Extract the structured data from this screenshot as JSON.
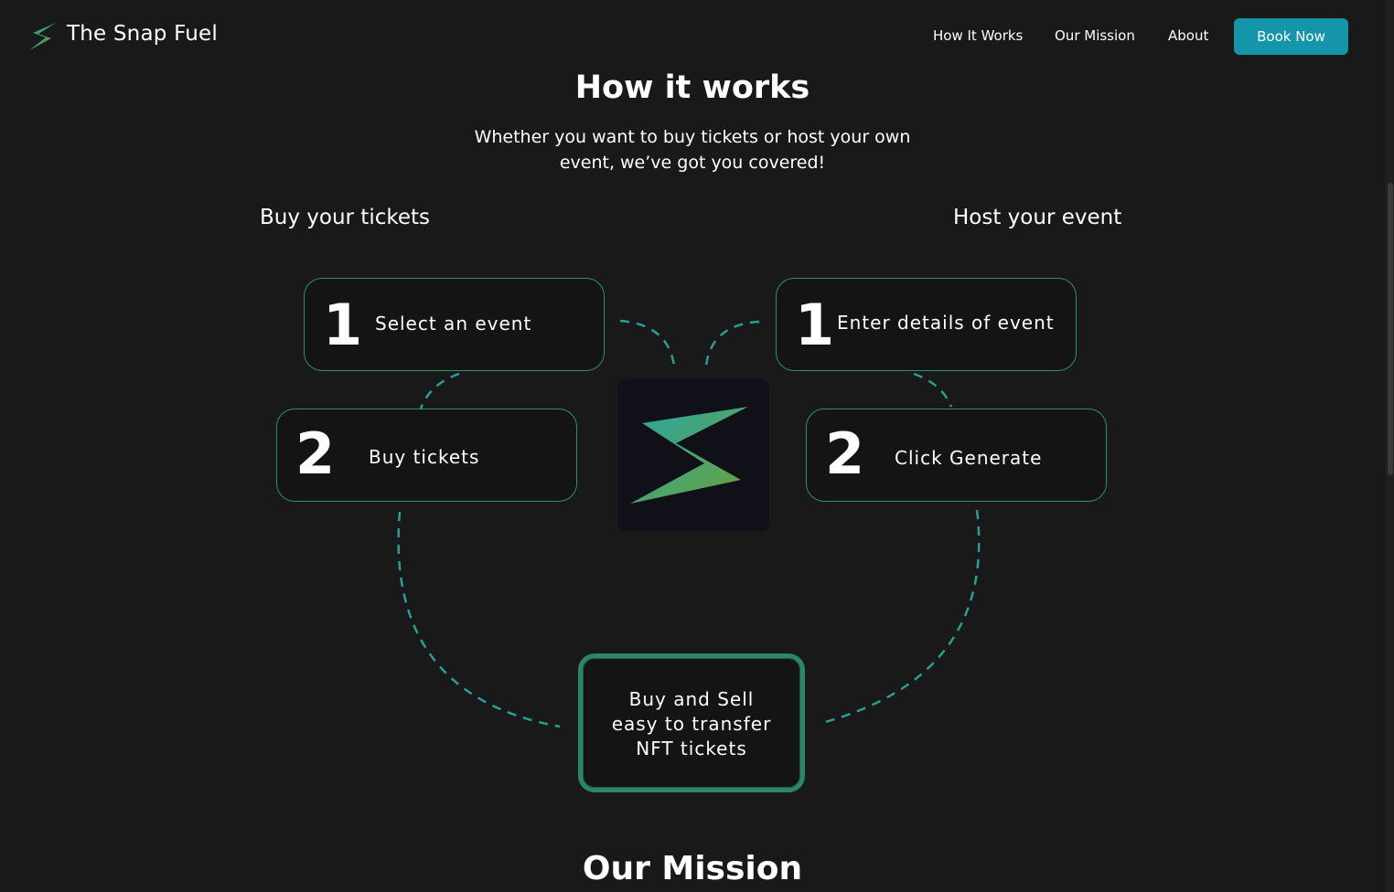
{
  "brand": {
    "name": "The Snap Fuel"
  },
  "nav": {
    "links": [
      "How It Works",
      "Our Mission",
      "About"
    ],
    "cta": "Book Now"
  },
  "section": {
    "title": "How it works",
    "subtitle_line1": "Whether you want to buy tickets or host your own",
    "subtitle_line2": "event, we’ve got you covered!"
  },
  "buy": {
    "heading": "Buy your tickets",
    "steps": [
      {
        "num": "1",
        "label": "Select an event"
      },
      {
        "num": "2",
        "label": "Buy tickets"
      }
    ]
  },
  "host": {
    "heading": "Host your event",
    "steps": [
      {
        "num": "1",
        "label": "Enter details of event"
      },
      {
        "num": "2",
        "label": "Click Generate"
      }
    ]
  },
  "final": {
    "line1": "Buy and Sell",
    "line2": "easy to transfer",
    "line3": "NFT tickets"
  },
  "next_section": {
    "title": "Our Mission"
  },
  "colors": {
    "background": "#191919",
    "accent": "#1595a9",
    "card_border": "#2e8f6f",
    "connector": "#2a9d95"
  },
  "icons": [
    "lightning-logo-icon",
    "center-lightning-logo-icon"
  ]
}
